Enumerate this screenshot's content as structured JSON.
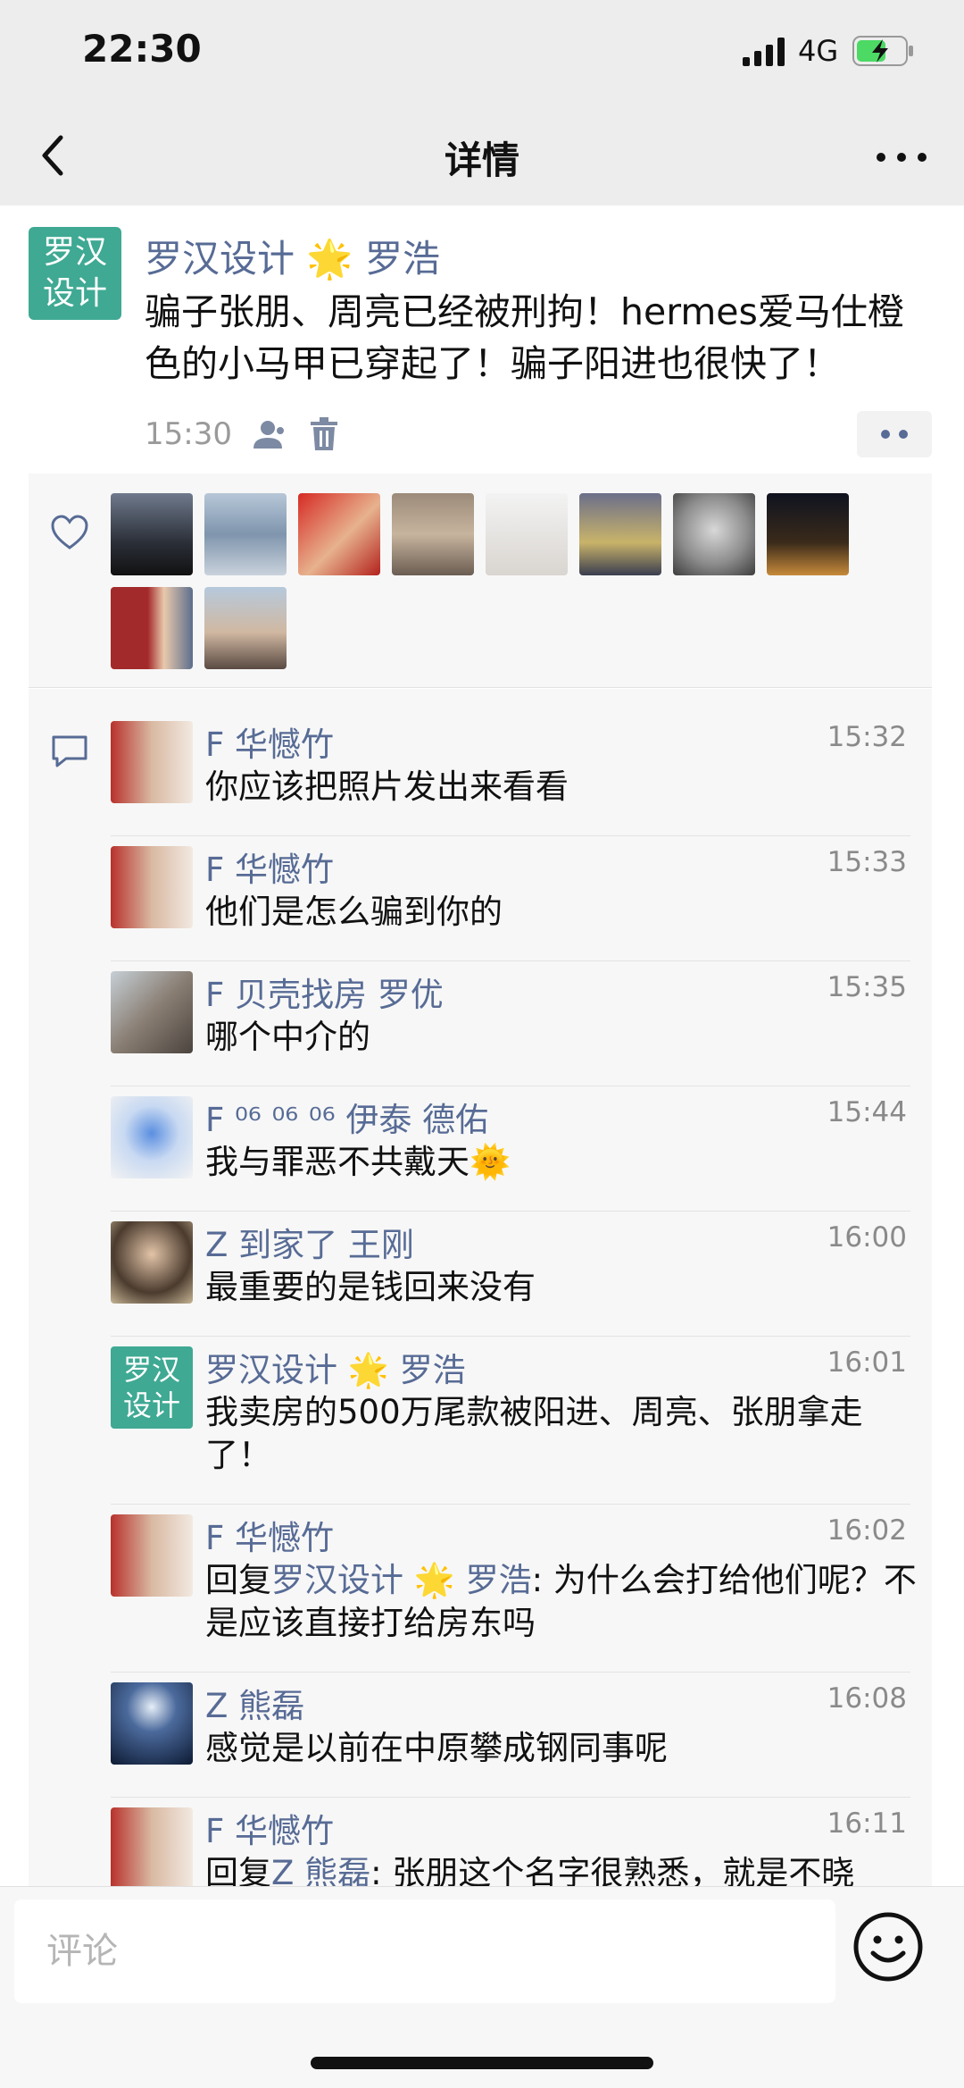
{
  "status": {
    "time": "22:30",
    "network": "4G"
  },
  "nav": {
    "title": "详情"
  },
  "post": {
    "avatar_text": "罗汉设计",
    "avatar_line1": "罗汉",
    "avatar_line2": "设计",
    "author": "罗汉设计 🌟 罗浩",
    "text": "骗子张朋、周亮已经被刑拘！hermes爱马仕橙色的小马甲已穿起了！骗子阳进也很快了！",
    "time": "15:30"
  },
  "likes_count_shown": 10,
  "comments": [
    {
      "name": "F 华憾竹",
      "time": "15:32",
      "text": "你应该把照片发出来看看"
    },
    {
      "name": "F 华憾竹",
      "time": "15:33",
      "text": "他们是怎么骗到你的"
    },
    {
      "name": "F 贝壳找房  罗优",
      "time": "15:35",
      "text": "哪个中介的"
    },
    {
      "name": "F ⁰⁶ ⁰⁶ ⁰⁶ 伊泰 德佑",
      "time": "15:44",
      "text": "我与罪恶不共戴天🌞"
    },
    {
      "name": "Z 到家了 王刚",
      "time": "16:00",
      "text": "最重要的是钱回来没有"
    },
    {
      "name": "罗汉设计 🌟 罗浩",
      "time": "16:01",
      "text": "我卖房的500万尾款被阳进、周亮、张朋拿走了！",
      "avatar_line1": "罗汉",
      "avatar_line2": "设计"
    },
    {
      "name": "F 华憾竹",
      "time": "16:02",
      "reply_prefix": "回复",
      "reply_to": "罗汉设计 🌟 罗浩",
      "text": ": 为什么会打给他们呢？不是应该直接打给房东吗"
    },
    {
      "name": "Z 熊磊",
      "time": "16:08",
      "text": "感觉是以前在中原攀成钢同事呢"
    },
    {
      "name": "F 华憾竹",
      "time": "16:11",
      "reply_prefix": "回复",
      "reply_to": "Z 熊磊",
      "text": ": 张朋这个名字很熟悉，就是不晓"
    }
  ],
  "input": {
    "placeholder": "评论"
  },
  "icons": {
    "back": "chevron-left-icon",
    "more": "more-horizontal-icon",
    "like": "heart-outline-icon",
    "comment": "comment-bubble-icon",
    "visibility": "users-icon",
    "delete": "trash-icon",
    "emoji": "emoji-smile-icon"
  },
  "colors": {
    "link": "#576b95",
    "avatar_brand": "#3fa993",
    "background": "#ededed"
  }
}
